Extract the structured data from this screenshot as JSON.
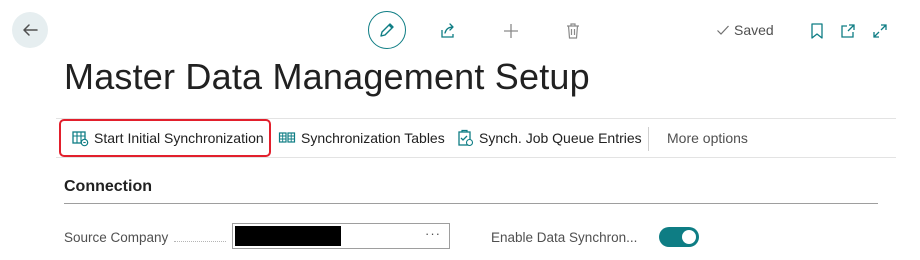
{
  "header": {
    "saved_label": "Saved"
  },
  "page": {
    "title": "Master Data Management Setup"
  },
  "actions": [
    {
      "label": "Start Initial Synchronization"
    },
    {
      "label": "Synchronization Tables"
    },
    {
      "label": "Synch. Job Queue Entries"
    },
    {
      "label": "More options"
    }
  ],
  "section": {
    "title": "Connection"
  },
  "fields": {
    "source_company_label": "Source Company",
    "source_company_value": "",
    "source_company_lookup": "···",
    "enable_sync_label": "Enable Data Synchron...",
    "enable_sync_value": true
  },
  "colors": {
    "accent": "#0e7d84",
    "highlight": "#e21f2c"
  }
}
